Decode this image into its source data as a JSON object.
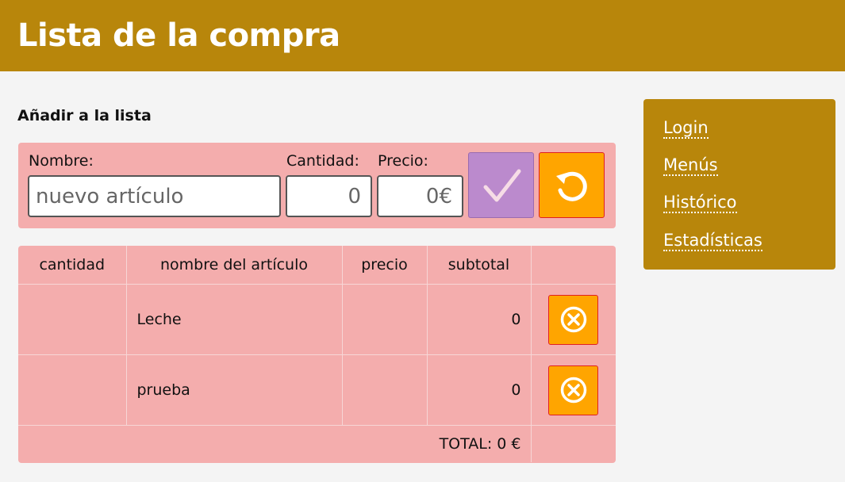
{
  "app": {
    "title": "Lista de la compra"
  },
  "form": {
    "section_title": "Añadir a la lista",
    "nombre_label": "Nombre:",
    "nombre_placeholder": "nuevo artículo",
    "nombre_value": "",
    "cantidad_label": "Cantidad:",
    "cantidad_value": "0",
    "precio_label": "Precio:",
    "precio_value": "0€",
    "confirm_icon": "check-icon",
    "reset_icon": "reset-icon"
  },
  "table": {
    "headers": [
      "cantidad",
      "nombre del artículo",
      "precio",
      "subtotal",
      ""
    ],
    "rows": [
      {
        "cantidad": "",
        "nombre": "Leche",
        "precio": "",
        "subtotal": "0"
      },
      {
        "cantidad": "",
        "nombre": "prueba",
        "precio": "",
        "subtotal": "0"
      }
    ],
    "total_label": "TOTAL: 0 €",
    "delete_icon": "delete-icon"
  },
  "nav": {
    "items": [
      {
        "label": "Login"
      },
      {
        "label": "Menús"
      },
      {
        "label": "Histórico"
      },
      {
        "label": "Estadísticas"
      }
    ]
  },
  "colors": {
    "header_bg": "#b8860b",
    "panel_bg": "#f4adad",
    "confirm_bg": "#bb8acd",
    "action_bg": "#ffa500",
    "action_border": "#e02020",
    "page_bg": "#f4f4f4"
  }
}
